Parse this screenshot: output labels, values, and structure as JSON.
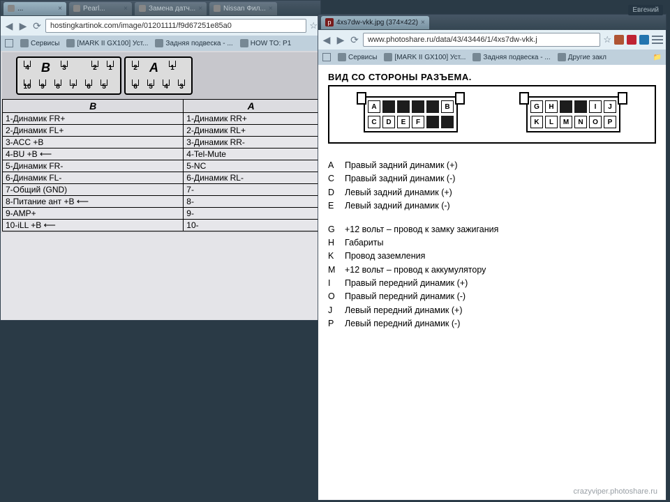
{
  "user_chip": "Евгений",
  "win1": {
    "tabs": [
      {
        "label": "..."
      },
      {
        "label": "Pearl..."
      },
      {
        "label": "Замена датч..."
      },
      {
        "label": "Nissan Фил..."
      }
    ],
    "url": "hostingkartinok.com/image/01201111/f9d67251e85a0",
    "bookmarks": [
      {
        "label": "Сервисы"
      },
      {
        "label": "[MARK II GX100] Уст..."
      },
      {
        "label": "Задняя подвеска - ..."
      },
      {
        "label": "HOW TO: P1"
      }
    ],
    "connB_label": "B",
    "connA_label": "A",
    "connB_top": [
      "4",
      "3",
      "",
      "2",
      "1"
    ],
    "connB_bot": [
      "10",
      "9",
      "8",
      "7",
      "6",
      "5"
    ],
    "connA_top": [
      "2",
      "1"
    ],
    "connA_bot": [
      "6",
      "5",
      "4",
      "3"
    ],
    "table": {
      "headers": [
        "B",
        "A"
      ],
      "rows": [
        [
          "1-Динамик FR+",
          "1-Динамик RR+"
        ],
        [
          "2-Динамик FL+",
          "2-Динамик RL+"
        ],
        [
          "3-ACC +B",
          "3-Динамик RR-"
        ],
        [
          "4-BU +B   ⟵",
          "4-Tel-Mute"
        ],
        [
          "5-Динамик FR-",
          "5-NC"
        ],
        [
          "6-Динамик FL-",
          "6-Динамик RL-"
        ],
        [
          "7-Общий (GND)",
          "7-"
        ],
        [
          "8-Питание ант +B   ⟵",
          "8-"
        ],
        [
          "9-AMP+",
          "9-"
        ],
        [
          "10-iLL +B   ⟵",
          "10-"
        ]
      ]
    }
  },
  "win2": {
    "tab": {
      "label": "4xs7dw-vkk.jpg (374×422)"
    },
    "url": "www.photoshare.ru/data/43/43446/1/4xs7dw-vkk.j",
    "bookmarks": [
      {
        "label": "Сервисы"
      },
      {
        "label": "[MARK II GX100] Уст..."
      },
      {
        "label": "Задняя подвеска - ..."
      },
      {
        "label": "Другие закл"
      }
    ],
    "title": "ВИД СО СТОРОНЫ РАЗЪЕМА.",
    "blk1": {
      "top": [
        "A",
        "",
        "",
        "",
        "",
        "B"
      ],
      "bot": [
        "C",
        "D",
        "E",
        "F",
        "",
        ""
      ]
    },
    "blk2": {
      "top": [
        "G",
        "H",
        "",
        "",
        "I",
        "J"
      ],
      "bot": [
        "K",
        "L",
        "M",
        "N",
        "O",
        "P"
      ]
    },
    "list": [
      {
        "k": "A",
        "v": "Правый задний динамик (+)"
      },
      {
        "k": "C",
        "v": "Правый задний динамик (-)"
      },
      {
        "k": "D",
        "v": "Левый задний динамик (+)"
      },
      {
        "k": "E",
        "v": "Левый задний динамик (-)"
      },
      {
        "gap": true
      },
      {
        "k": "G",
        "v": "+12 вольт – провод к замку зажигания"
      },
      {
        "k": "H",
        "v": "Габариты"
      },
      {
        "k": "K",
        "v": "Провод заземления"
      },
      {
        "k": "M",
        "v": "+12 вольт – провод к аккумулятору"
      },
      {
        "k": "I",
        "v": "Правый передний динамик (+)"
      },
      {
        "k": "O",
        "v": "Правый передний динамик (-)"
      },
      {
        "k": "J",
        "v": "Левый передний динамик (+)"
      },
      {
        "k": "P",
        "v": "Левый передний динамик (-)"
      }
    ],
    "watermark": "crazyviper.photoshare.ru"
  }
}
